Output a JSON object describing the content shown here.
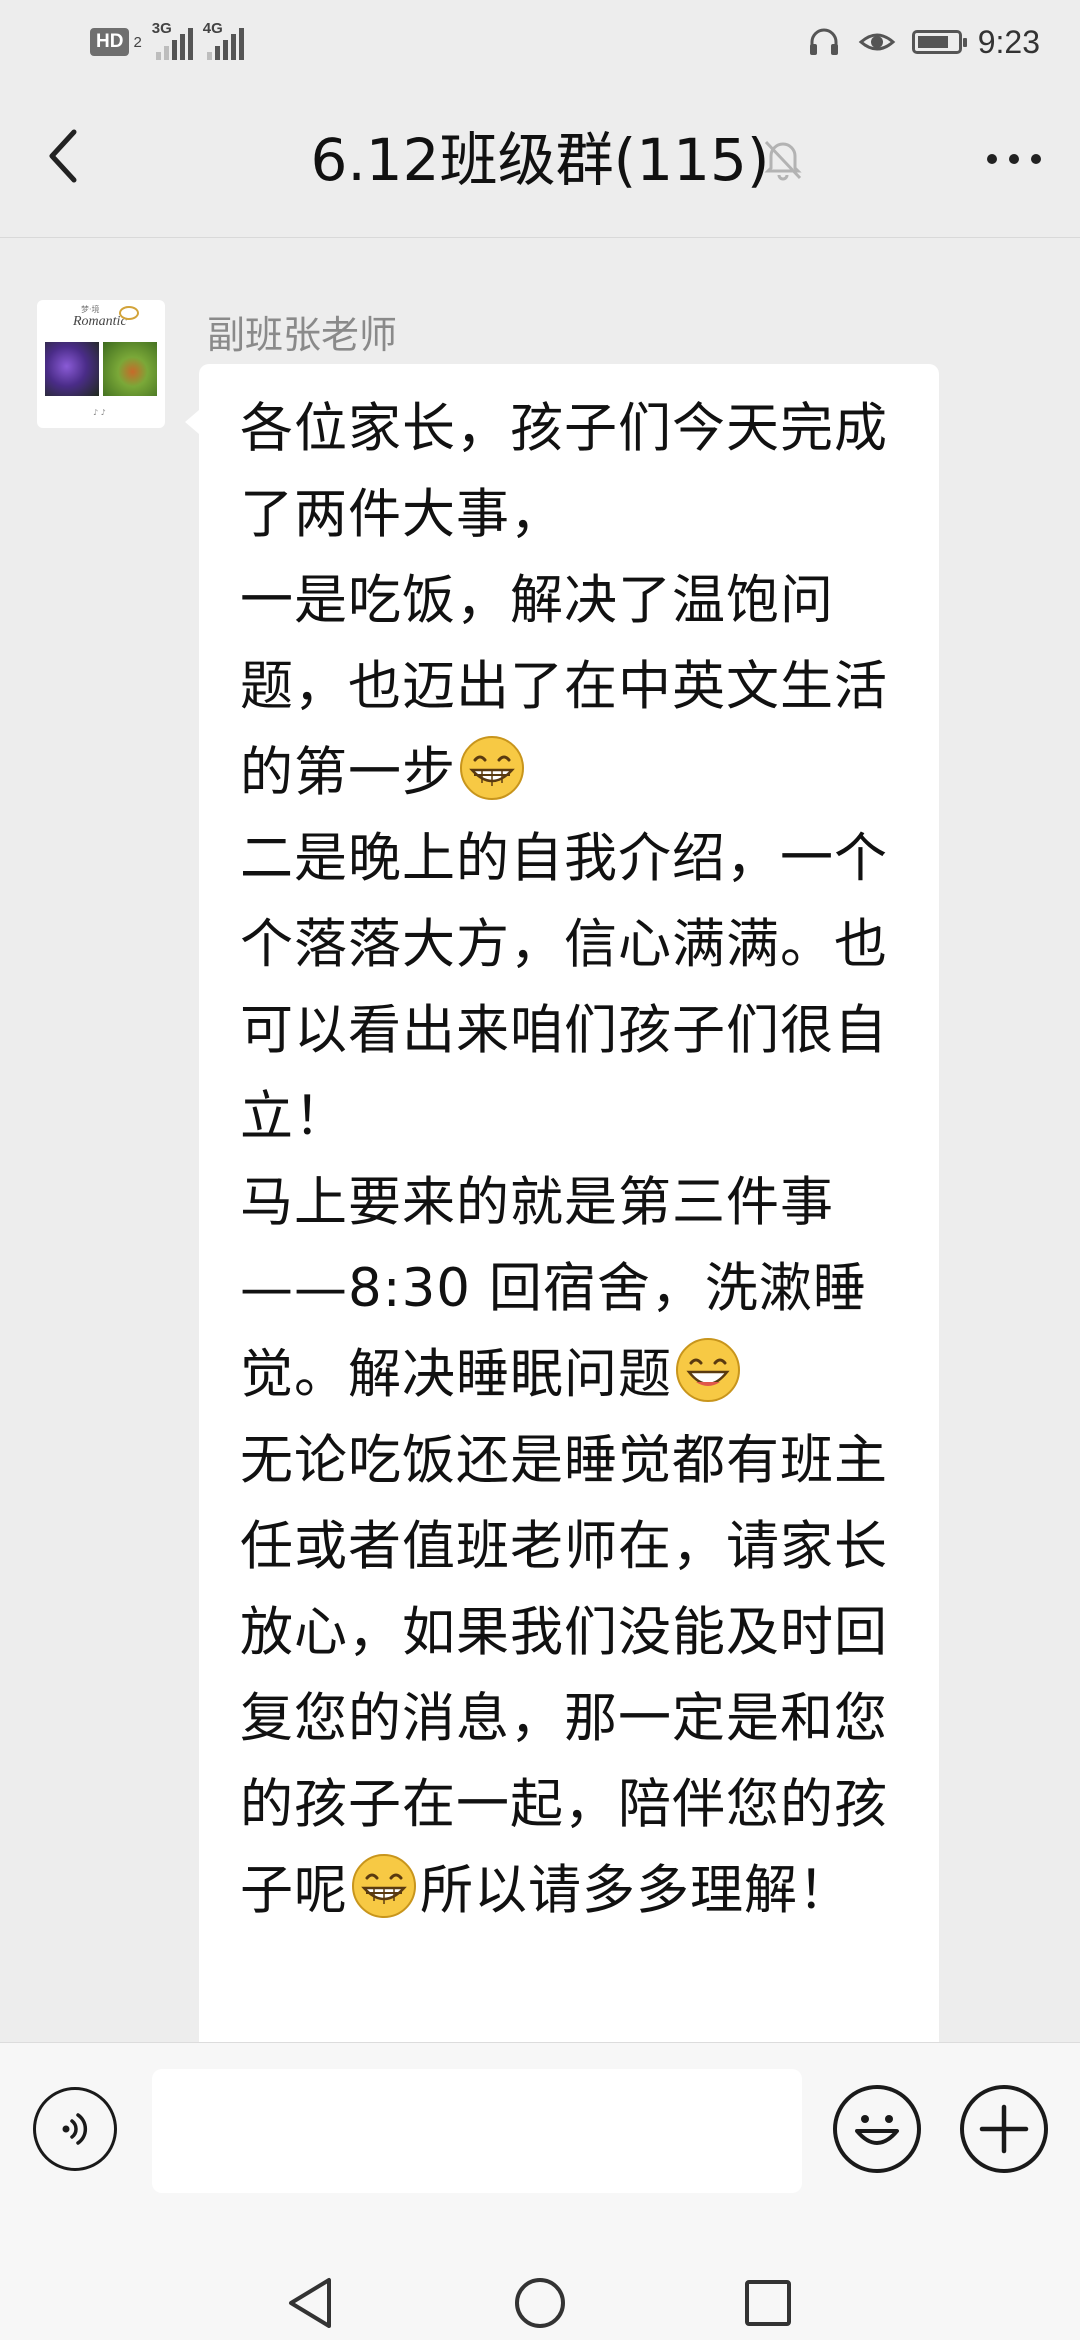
{
  "status_bar": {
    "hd_label": "HD",
    "hd_sub": "2",
    "net1_label": "3G",
    "net2_label": "4G",
    "time": "9:23",
    "battery_level": 0.8,
    "icons": [
      "headset-icon",
      "eye-icon",
      "battery-icon"
    ]
  },
  "header": {
    "title": "6.12班级群(115)",
    "back_icon": "chevron-left-icon",
    "mute_icon": "bell-muted-icon",
    "more_icon": "more-dots-icon"
  },
  "message": {
    "sender": "副班张老师",
    "avatar": {
      "word": "Romantic",
      "top_text": "梦·境",
      "footer_text": "♪ ♪"
    },
    "paragraphs": [
      {
        "text": "各位家长，孩子们今天完成了两件大事，",
        "emoji": ""
      },
      {
        "text": "一是吃饭，解决了温饱问题，也迈出了在中英文生活的第一步",
        "emoji": "grin-emoji"
      },
      {
        "text": "二是晚上的自我介绍，一个个落落大方，信心满满。也可以看出来咱们孩子们很自立！",
        "emoji": ""
      },
      {
        "text": "马上要来的就是第三件事——8:30 回宿舍，洗漱睡觉。解决睡眠问题",
        "emoji": "smile-emoji"
      },
      {
        "text": "无论吃饭还是睡觉都有班主任或者值班老师在，请家长放心，如果我们没能及时回复您的消息，那一定是和您的孩子在一起，陪伴您的孩子呢",
        "emoji": "grin-emoji"
      },
      {
        "text": "所以请多多理解！",
        "emoji": ""
      }
    ]
  },
  "input_bar": {
    "value": "",
    "placeholder": "",
    "voice_icon": "voice-icon",
    "emoji_icon": "emoji-icon",
    "plus_icon": "plus-icon"
  },
  "system_nav": {
    "back_icon": "nav-back-icon",
    "home_icon": "nav-home-icon",
    "recents_icon": "nav-recents-icon"
  }
}
